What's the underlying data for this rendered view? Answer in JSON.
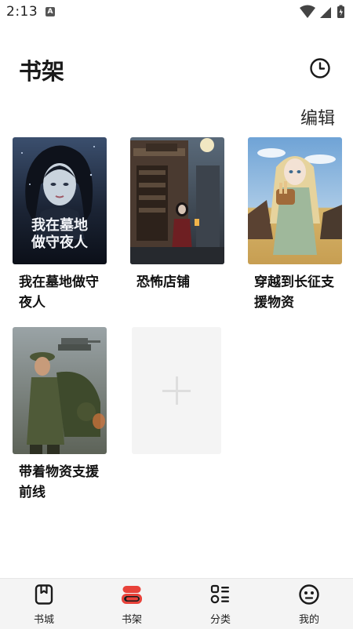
{
  "status_bar": {
    "time": "2:13",
    "notif_letter": "A"
  },
  "header": {
    "title": "书架",
    "edit_label": "编辑"
  },
  "books": [
    {
      "title": "我在墓地做守夜人",
      "cover_text": "我在墓地做守夜人"
    },
    {
      "title": "恐怖店铺"
    },
    {
      "title": "穿越到长征支援物资"
    },
    {
      "title": "带着物资支援前线"
    }
  ],
  "add_book": {
    "icon": "plus-icon"
  },
  "bottom_nav": {
    "items": [
      {
        "label": "书城",
        "icon": "bookstore-icon",
        "active": false
      },
      {
        "label": "书架",
        "icon": "bookshelf-icon",
        "active": true
      },
      {
        "label": "分类",
        "icon": "category-icon",
        "active": false
      },
      {
        "label": "我的",
        "icon": "profile-icon",
        "active": false
      }
    ]
  },
  "colors": {
    "accent": "#e8423a",
    "nav_bg": "#f4f4f4",
    "add_card_bg": "#f4f4f4"
  }
}
